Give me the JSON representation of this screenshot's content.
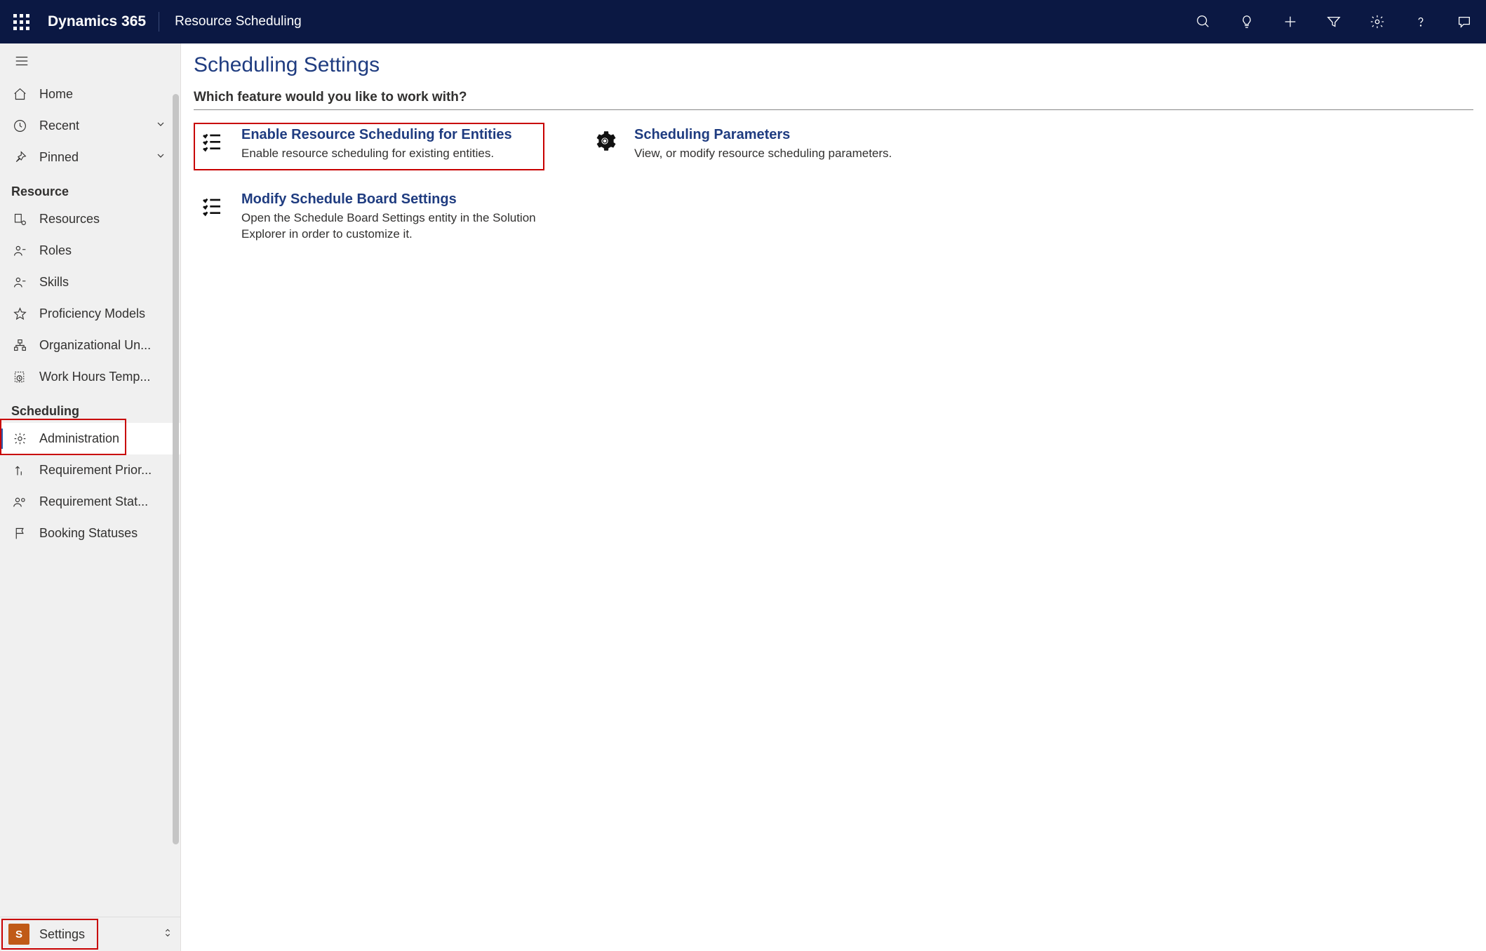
{
  "topbar": {
    "brand": "Dynamics 365",
    "app": "Resource Scheduling"
  },
  "nav": {
    "top": [
      {
        "id": "home",
        "label": "Home",
        "icon": "home",
        "expandable": false
      },
      {
        "id": "recent",
        "label": "Recent",
        "icon": "clock",
        "expandable": true
      },
      {
        "id": "pinned",
        "label": "Pinned",
        "icon": "pin",
        "expandable": true
      }
    ],
    "groups": [
      {
        "title": "Resource",
        "items": [
          {
            "id": "resources",
            "label": "Resources",
            "icon": "resources"
          },
          {
            "id": "roles",
            "label": "Roles",
            "icon": "person"
          },
          {
            "id": "skills",
            "label": "Skills",
            "icon": "person"
          },
          {
            "id": "prof",
            "label": "Proficiency Models",
            "icon": "star"
          },
          {
            "id": "org",
            "label": "Organizational Un...",
            "icon": "org"
          },
          {
            "id": "wht",
            "label": "Work Hours Temp...",
            "icon": "template"
          }
        ]
      },
      {
        "title": "Scheduling",
        "items": [
          {
            "id": "admin",
            "label": "Administration",
            "icon": "gear",
            "selected": true,
            "highlighted": true
          },
          {
            "id": "reqprio",
            "label": "Requirement Prior...",
            "icon": "priority"
          },
          {
            "id": "reqstat",
            "label": "Requirement Stat...",
            "icon": "persongroup"
          },
          {
            "id": "bookstat",
            "label": "Booking Statuses",
            "icon": "flag"
          }
        ]
      }
    ],
    "area": {
      "tile": "S",
      "label": "Settings",
      "highlighted": true
    }
  },
  "main": {
    "title": "Scheduling Settings",
    "prompt": "Which feature would you like to work with?",
    "left_cards": [
      {
        "id": "enable",
        "title": "Enable Resource Scheduling for Entities",
        "desc": "Enable resource scheduling for existing entities.",
        "icon": "checklist",
        "highlighted": true
      },
      {
        "id": "modify",
        "title": "Modify Schedule Board Settings",
        "desc": "Open the Schedule Board Settings entity in the Solution Explorer in order to customize it.",
        "icon": "checklist"
      }
    ],
    "right_cards": [
      {
        "id": "params",
        "title": "Scheduling Parameters",
        "desc": "View, or modify resource scheduling parameters.",
        "icon": "gear-solid"
      }
    ]
  }
}
